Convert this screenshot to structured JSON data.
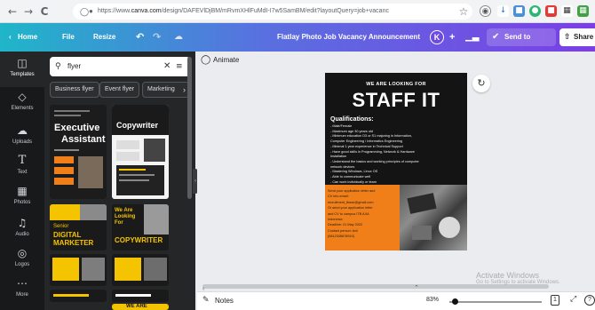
{
  "browser": {
    "back": "←",
    "forward": "→",
    "reload": "C",
    "url_prefix": "https://www.",
    "url_domain": "canva.com",
    "url_rest": "/design/DAFEVlDjBM/mRvmXHlFuMdI-I7w5SamBM/edit?layoutQuery=job+vacanc"
  },
  "topbar": {
    "home": "Home",
    "file": "File",
    "resize": "Resize",
    "title": "Flatlay Photo Job Vacancy Announcement",
    "avatar_initial": "K",
    "send": "Send to teacher",
    "share": "Share"
  },
  "rail": {
    "items": [
      {
        "label": "Templates",
        "icon": "templates-icon"
      },
      {
        "label": "Elements",
        "icon": "elements-icon"
      },
      {
        "label": "Uploads",
        "icon": "uploads-icon"
      },
      {
        "label": "Text",
        "icon": "text-icon"
      },
      {
        "label": "Photos",
        "icon": "photos-icon"
      },
      {
        "label": "Audio",
        "icon": "audio-icon"
      },
      {
        "label": "Logos",
        "icon": "logos-icon"
      },
      {
        "label": "More",
        "icon": "more-icon"
      }
    ]
  },
  "panel": {
    "search_value": "flyer",
    "chips": [
      "Business flyer",
      "Event flyer",
      "Marketing"
    ]
  },
  "thumbs": {
    "t1_title": "Executive",
    "t1_sub": "Assistant",
    "t2_title": "Copywriter",
    "t3_title": "We Are Looking For",
    "t4_label": "Senior",
    "t4_title": "DIGITAL MARKETER",
    "t5_title": "COPYWRITER",
    "t6_title": "WE ARE"
  },
  "editor": {
    "animate": "Animate",
    "notes": "Notes",
    "zoom": "83%"
  },
  "design": {
    "kicker": "WE ARE LOOKING FOR",
    "headline": "STAFF IT",
    "qual_title": "Qualifications:",
    "qualifications": [
      "- Male/Female",
      "- Maximum age 30 years old",
      "- Minimum education D3 or S1 majoring in Information,",
      "Computer Engineering / Informatics Engineering",
      "- Minimal 1 year experience in Technical Support",
      "- Have good skills in Programming, Network & Hardware",
      "Installation",
      "- Understand the basics and working principles of computer",
      "network devices",
      "- Mastering Windows, Linux OS",
      "- Able to communicate well",
      "- Can work individually or team"
    ],
    "apply_lines": [
      "Send your application letter and",
      "CV into email:",
      "recruitment_tbase@gmail.com",
      "Or send your application letter",
      "and CV to campus ITB AXA",
      "Indonesia",
      "Deadline: 21 May 2022",
      "Contact person: Axil",
      "(0812345678910)"
    ]
  },
  "watermark": {
    "title": "Activate Windows",
    "sub": "Go to Settings to activate Windows."
  },
  "colors": {
    "canva_gradient_start": "#1fb6c8",
    "canva_gradient_end": "#7b3fe4",
    "design_orange": "#f07f1a",
    "design_dark": "#141414"
  }
}
